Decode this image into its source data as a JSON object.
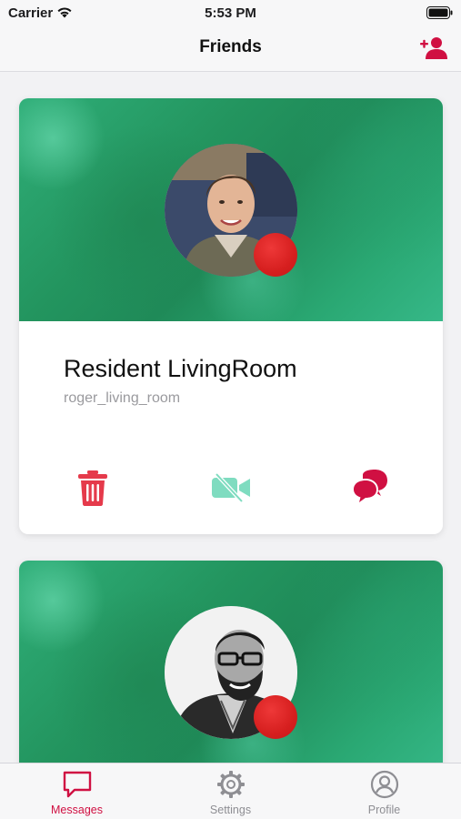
{
  "status_bar": {
    "carrier": "Carrier",
    "time": "5:53 PM"
  },
  "nav": {
    "title": "Friends",
    "add_friend_icon": "person-plus-icon"
  },
  "colors": {
    "accent": "#d01042",
    "delete": "#e53a4b",
    "video_disabled": "#7fdcc0",
    "status_offline": "#d61f1f",
    "banner_green": "#23955f",
    "tab_inactive": "#8e8e93"
  },
  "friends": [
    {
      "name": "Resident LivingRoom",
      "username": "roger_living_room",
      "status": "offline",
      "actions": [
        "trash-icon",
        "video-off-icon",
        "chat-bubbles-icon"
      ]
    },
    {
      "status": "offline"
    }
  ],
  "tab_bar": {
    "tabs": [
      {
        "label": "Messages",
        "icon": "chat-bubble-icon",
        "active": true
      },
      {
        "label": "Settings",
        "icon": "gear-icon",
        "active": false
      },
      {
        "label": "Profile",
        "icon": "person-circle-icon",
        "active": false
      }
    ]
  }
}
